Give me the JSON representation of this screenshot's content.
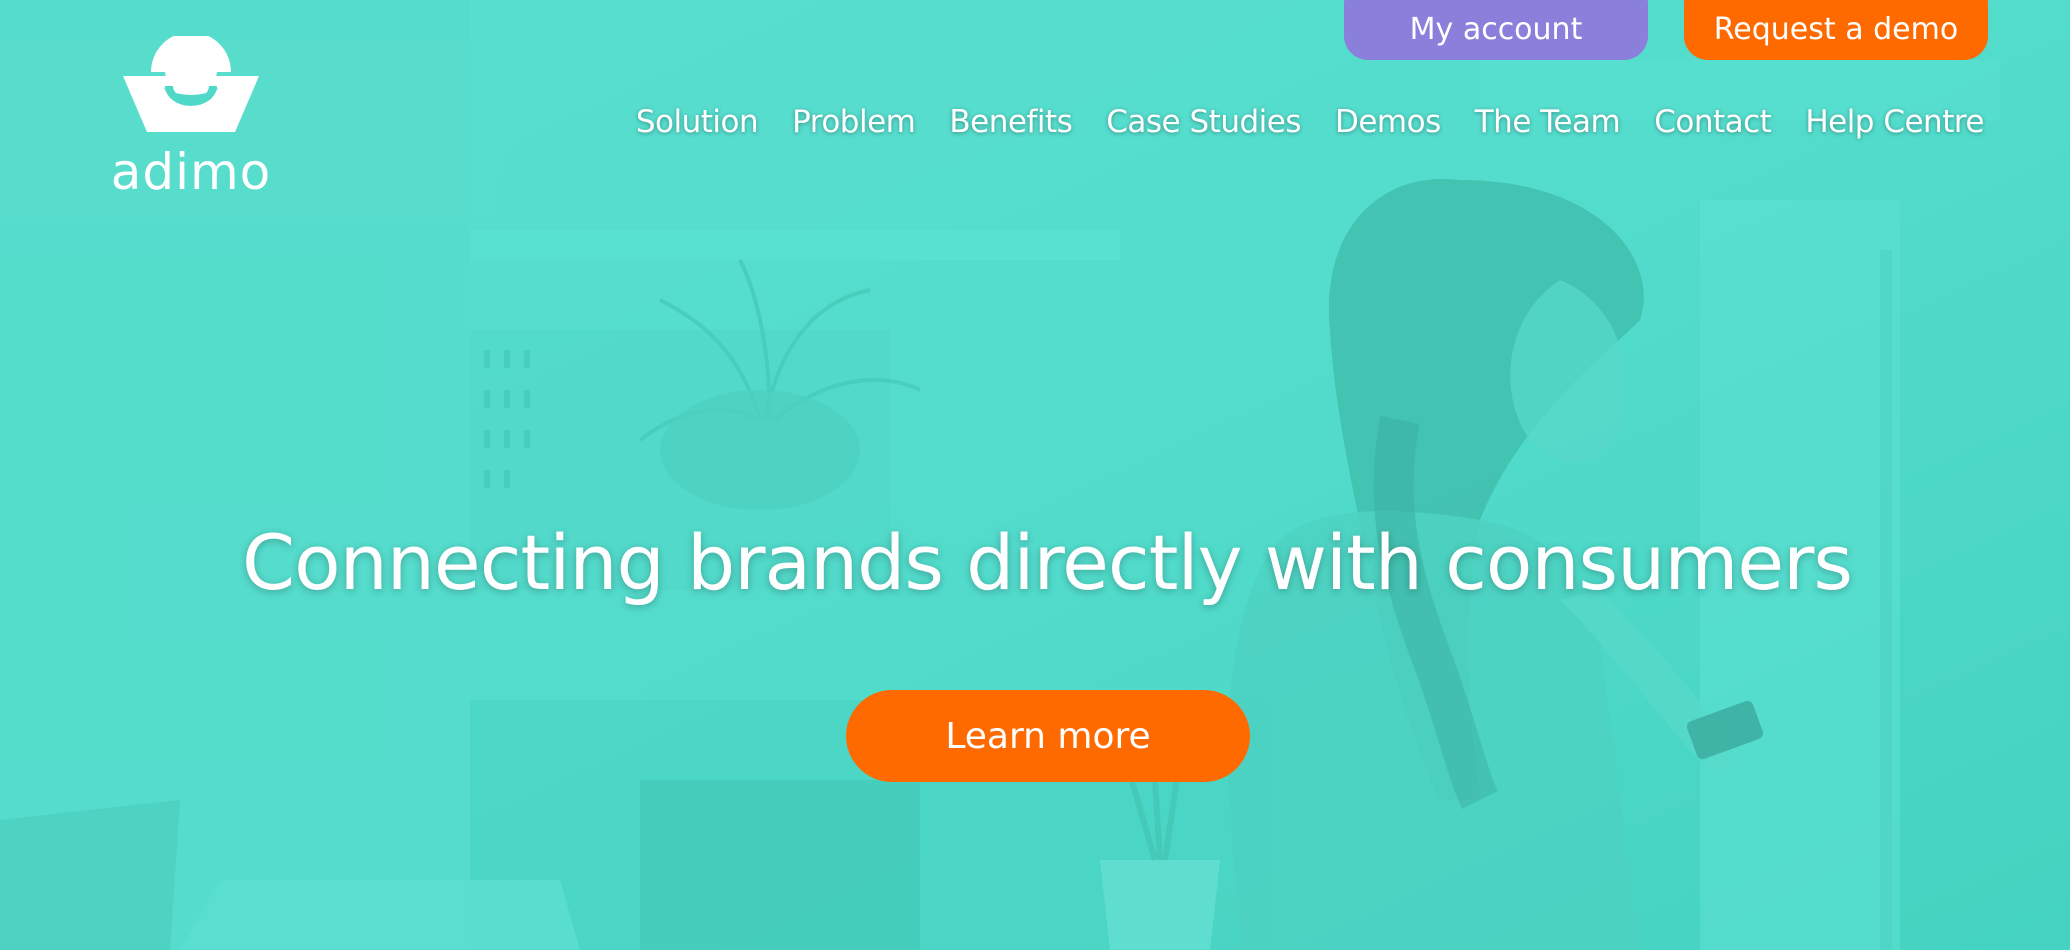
{
  "brand": {
    "logo_text": "adimo"
  },
  "header": {
    "account_label": "My account",
    "demo_label": "Request a demo"
  },
  "nav": {
    "items": [
      {
        "label": "Solution"
      },
      {
        "label": "Problem"
      },
      {
        "label": "Benefits"
      },
      {
        "label": "Case Studies"
      },
      {
        "label": "Demos"
      },
      {
        "label": "The Team"
      },
      {
        "label": "Contact"
      },
      {
        "label": "Help Centre"
      }
    ]
  },
  "hero": {
    "headline": "Connecting brands directly with consumers",
    "cta_label": "Learn more"
  },
  "colors": {
    "teal_overlay": "#4fd9c8",
    "orange": "#ff6a00",
    "purple": "#8b7fdc",
    "white": "#ffffff"
  }
}
